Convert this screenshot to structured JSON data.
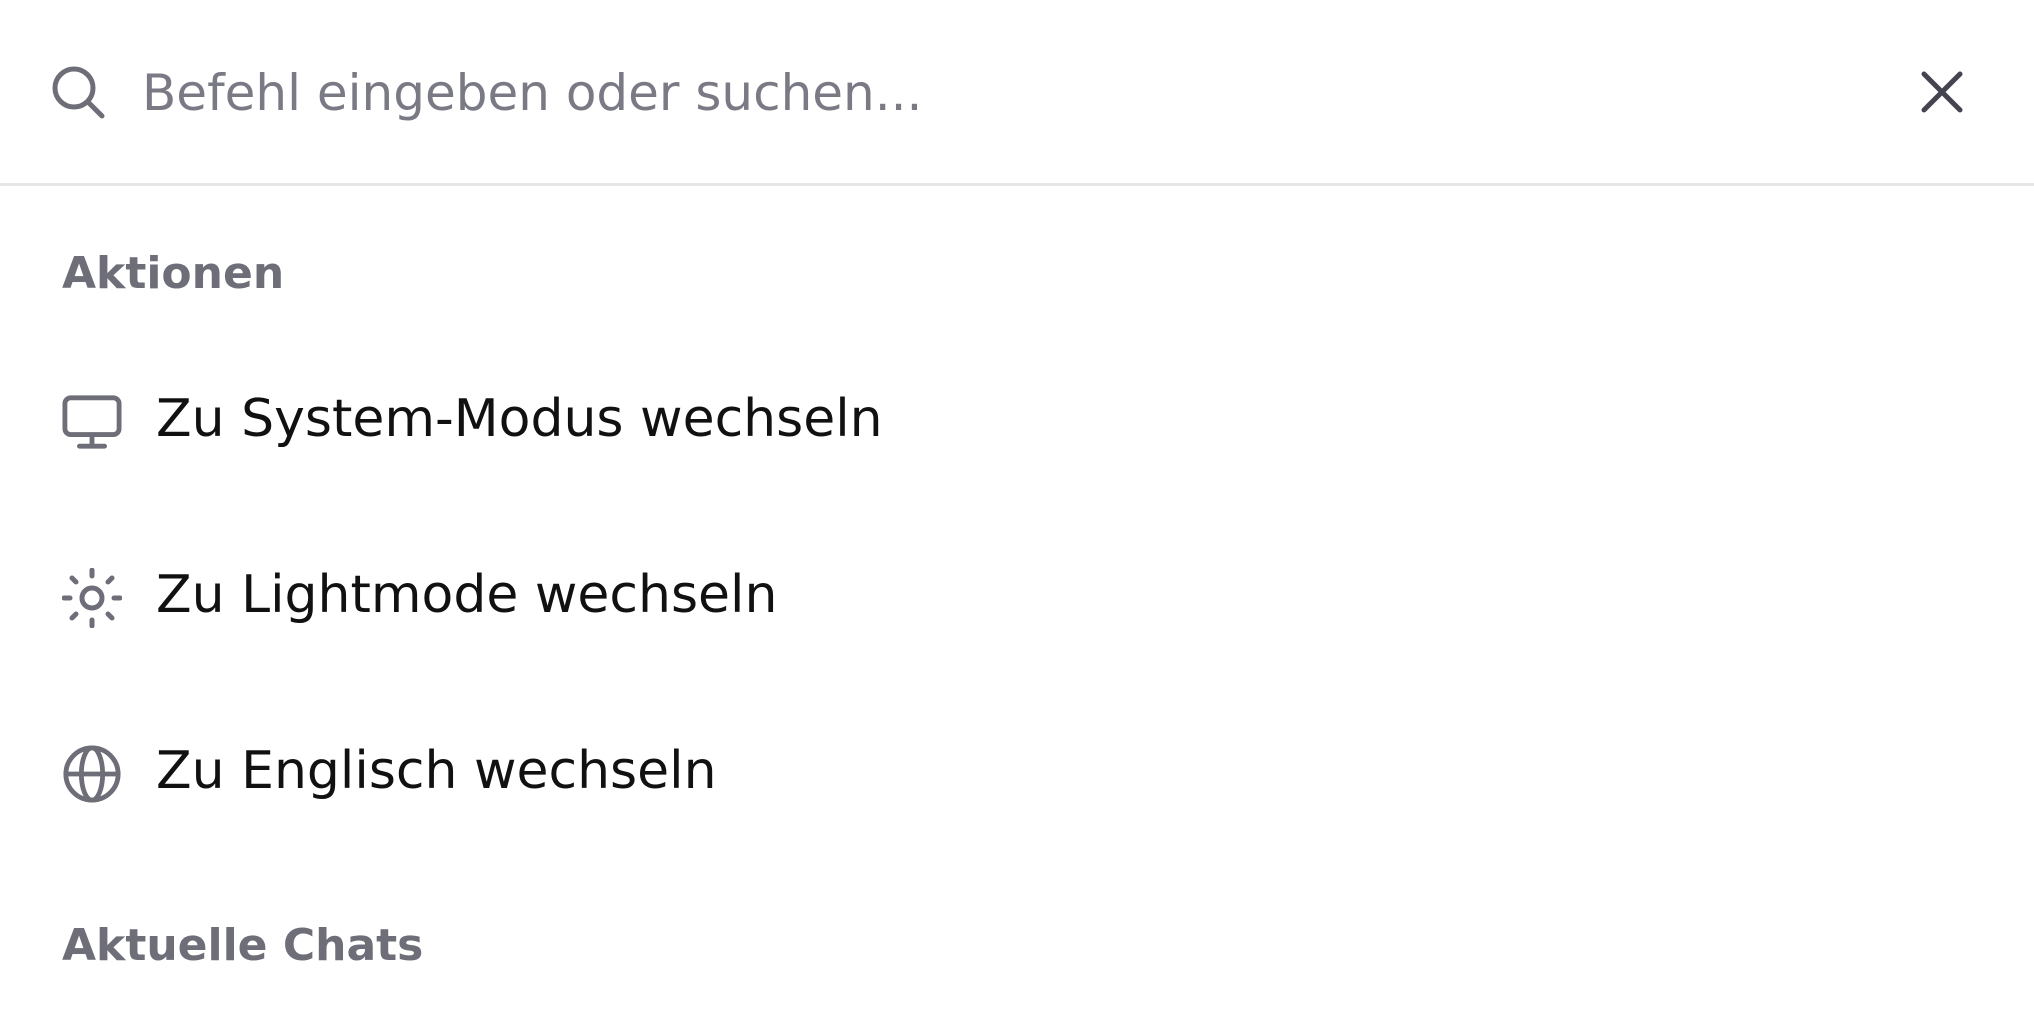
{
  "search": {
    "placeholder": "Befehl eingeben oder suchen...",
    "value": ""
  },
  "icons": {
    "search": "search-icon",
    "close": "close-icon",
    "system_mode": "monitor-icon",
    "light_mode": "sun-icon",
    "language": "globe-icon"
  },
  "colors": {
    "icon": "#6e6e78",
    "heading": "#6e6e78",
    "text": "#111111",
    "placeholder": "#7a7a85",
    "divider": "#e6e6e8"
  },
  "sections": {
    "actions": {
      "heading": "Aktionen",
      "items": [
        {
          "label": "Zu System-Modus wechseln",
          "icon": "monitor-icon"
        },
        {
          "label": "Zu Lightmode wechseln",
          "icon": "sun-icon"
        },
        {
          "label": "Zu Englisch wechseln",
          "icon": "globe-icon"
        }
      ]
    },
    "recent_chats": {
      "heading": "Aktuelle Chats"
    }
  }
}
